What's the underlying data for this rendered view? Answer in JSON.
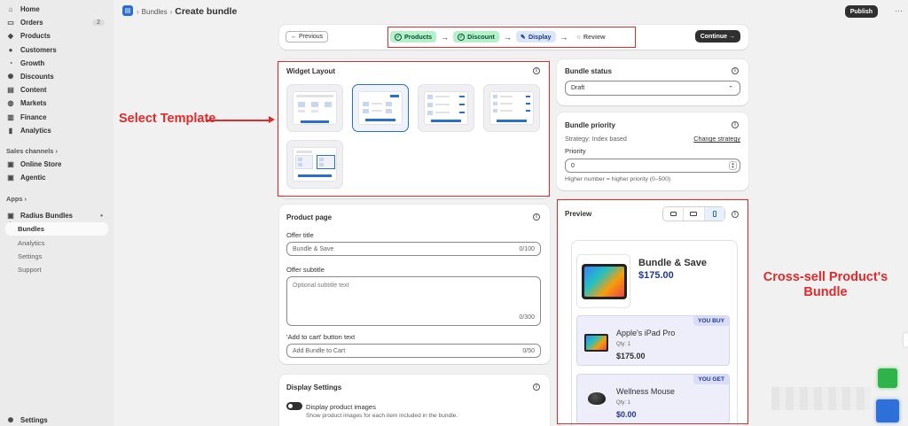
{
  "sidebar": {
    "items": [
      {
        "label": "Home",
        "icon": "home-icon",
        "glyph": "⌂"
      },
      {
        "label": "Orders",
        "icon": "inbox-icon",
        "glyph": "▭",
        "badge": "2"
      },
      {
        "label": "Products",
        "icon": "tag-icon",
        "glyph": "◆"
      },
      {
        "label": "Customers",
        "icon": "person-icon",
        "glyph": "●"
      },
      {
        "label": "Growth",
        "icon": "growth-icon",
        "glyph": "◔"
      },
      {
        "label": "Discounts",
        "icon": "discount-icon",
        "glyph": "✺"
      },
      {
        "label": "Content",
        "icon": "content-icon",
        "glyph": "▤"
      },
      {
        "label": "Markets",
        "icon": "globe-icon",
        "glyph": "◍"
      },
      {
        "label": "Finance",
        "icon": "bank-icon",
        "glyph": "▥"
      },
      {
        "label": "Analytics",
        "icon": "chart-icon",
        "glyph": "▮"
      }
    ],
    "sales_channels_label": "Sales channels ›",
    "channels": [
      {
        "label": "Online Store",
        "icon": "store-icon",
        "glyph": "▣"
      },
      {
        "label": "Agentic",
        "icon": "agentic-icon",
        "glyph": "▣"
      }
    ],
    "apps_label": "Apps ›",
    "app": {
      "label": "Radius Bundles",
      "dot": "•"
    },
    "app_subitems": [
      "Bundles",
      "Analytics",
      "Settings",
      "Support"
    ],
    "settings_label": "Settings"
  },
  "topbar": {
    "breadcrumb_parent": "Bundles",
    "separator": "›",
    "title": "Create bundle",
    "publish": "Publish",
    "more": "···"
  },
  "steps_bar": {
    "previous": "← Previous",
    "steps": [
      {
        "label": "Products",
        "state": "done"
      },
      {
        "label": "Discount",
        "state": "done"
      },
      {
        "label": "Display",
        "state": "active"
      },
      {
        "label": "Review",
        "state": "todo"
      }
    ],
    "arrow": "→",
    "continue": "Continue →"
  },
  "widget_layout": {
    "title": "Widget Layout"
  },
  "product_page": {
    "title": "Product page",
    "offer_title_label": "Offer title",
    "offer_title_value": "Bundle & Save",
    "offer_title_count": "0/100",
    "offer_subtitle_label": "Offer subtitle",
    "offer_subtitle_placeholder": "Optional subtitle text",
    "offer_subtitle_count": "0/300",
    "cart_label": "'Add to cart' button text",
    "cart_value": "Add Bundle to Cart",
    "cart_count": "0/50"
  },
  "display_settings": {
    "title": "Display Settings",
    "toggle_label": "Display product images",
    "toggle_help": "Show product images for each item included in the bundle."
  },
  "bundle_status": {
    "title": "Bundle status",
    "value": "Draft"
  },
  "bundle_priority": {
    "title": "Bundle priority",
    "strategy": "Strategy: Index based",
    "change": "Change strategy",
    "priority_label": "Priority",
    "priority_value": "0",
    "help": "Higher number = higher priority (0–500)"
  },
  "preview": {
    "title": "Preview",
    "bundle_title": "Bundle & Save",
    "bundle_price": "$175.00",
    "items": [
      {
        "badge": "YOU BUY",
        "name": "Apple's iPad Pro",
        "qty": "Qty: 1",
        "price": "$175.00"
      },
      {
        "badge": "YOU GET",
        "name": "Wellness Mouse",
        "qty": "Qty: 1",
        "price": "$0.00"
      }
    ]
  },
  "annotations": {
    "select_template": "Select Template",
    "cross_sell": "Cross-sell Product's\nBundle"
  },
  "colors": {
    "accent": "#2c6ecb",
    "annotation": "#e12a2a",
    "done_green": "#b4f0c8",
    "active_blue": "#dbe6fb"
  }
}
